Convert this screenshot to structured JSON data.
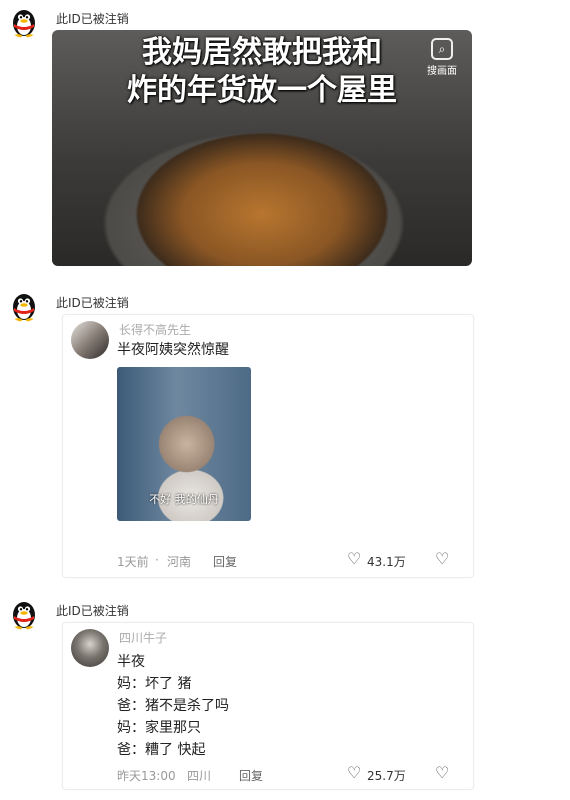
{
  "posts": [
    {
      "author": "此ID已被注销",
      "image_caption": "我妈居然敢把我和\n炸的年货放一个屋里",
      "lens_label": "搜画面"
    },
    {
      "author": "此ID已被注销",
      "quote": {
        "name": "长得不高先生",
        "text": "半夜阿姨突然惊醒",
        "image_subtitle": "不好 我的仙丹",
        "time": "1天前",
        "location": "河南",
        "reply": "回复",
        "likes": "43.1万"
      }
    },
    {
      "author": "此ID已被注销",
      "quote": {
        "name": "四川牛子",
        "lines": [
          "半夜",
          "妈：坏了 猪",
          "爸：猪不是杀了吗",
          "妈：家里那只",
          "爸：糟了 快起"
        ],
        "time": "昨天13:00",
        "location": "四川",
        "reply": "回复",
        "likes": "25.7万"
      }
    }
  ]
}
